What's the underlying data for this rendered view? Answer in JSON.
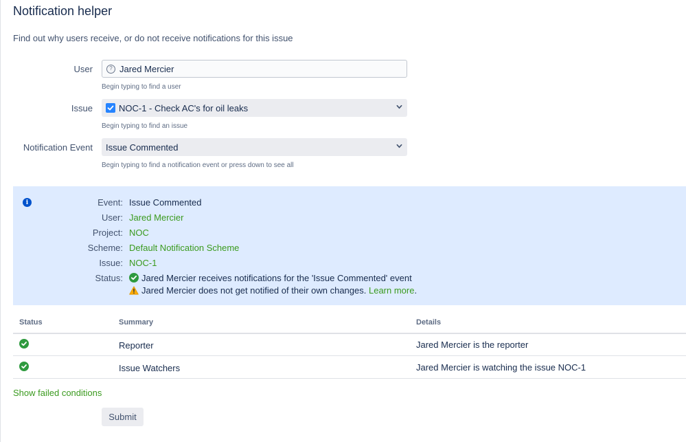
{
  "page": {
    "title": "Notification helper",
    "description": "Find out why users receive, or do not receive notifications for this issue"
  },
  "form": {
    "user": {
      "label": "User",
      "value": "Jared Mercier",
      "hint": "Begin typing to find a user"
    },
    "issue": {
      "label": "Issue",
      "value": "NOC-1 - Check AC's for oil leaks",
      "hint": "Begin typing to find an issue"
    },
    "event": {
      "label": "Notification Event",
      "value": "Issue Commented",
      "hint": "Begin typing to find a notification event or press down to see all"
    }
  },
  "info": {
    "event": {
      "key": "Event:",
      "value": "Issue Commented"
    },
    "user": {
      "key": "User:",
      "value": "Jared Mercier"
    },
    "project": {
      "key": "Project:",
      "value": "NOC"
    },
    "scheme": {
      "key": "Scheme:",
      "value": "Default Notification Scheme"
    },
    "issue": {
      "key": "Issue:",
      "value": "NOC-1"
    },
    "status": {
      "key": "Status:",
      "line1": "Jared Mercier receives notifications for the 'Issue Commented' event",
      "line2": "Jared Mercier does not get notified of their own changes.",
      "learn_more": "Learn more",
      "period": "."
    }
  },
  "table": {
    "headers": {
      "status": "Status",
      "summary": "Summary",
      "details": "Details"
    },
    "rows": [
      {
        "summary": "Reporter",
        "details": "Jared Mercier is the reporter"
      },
      {
        "summary": "Issue Watchers",
        "details": "Jared Mercier is watching the issue NOC-1"
      }
    ]
  },
  "actions": {
    "show_failed": "Show failed conditions",
    "submit": "Submit"
  },
  "colors": {
    "link_green": "#3a9a1e",
    "panel_blue": "#deebff",
    "ok_green": "#2e9a3e",
    "warning_yellow": "#ffab00"
  }
}
